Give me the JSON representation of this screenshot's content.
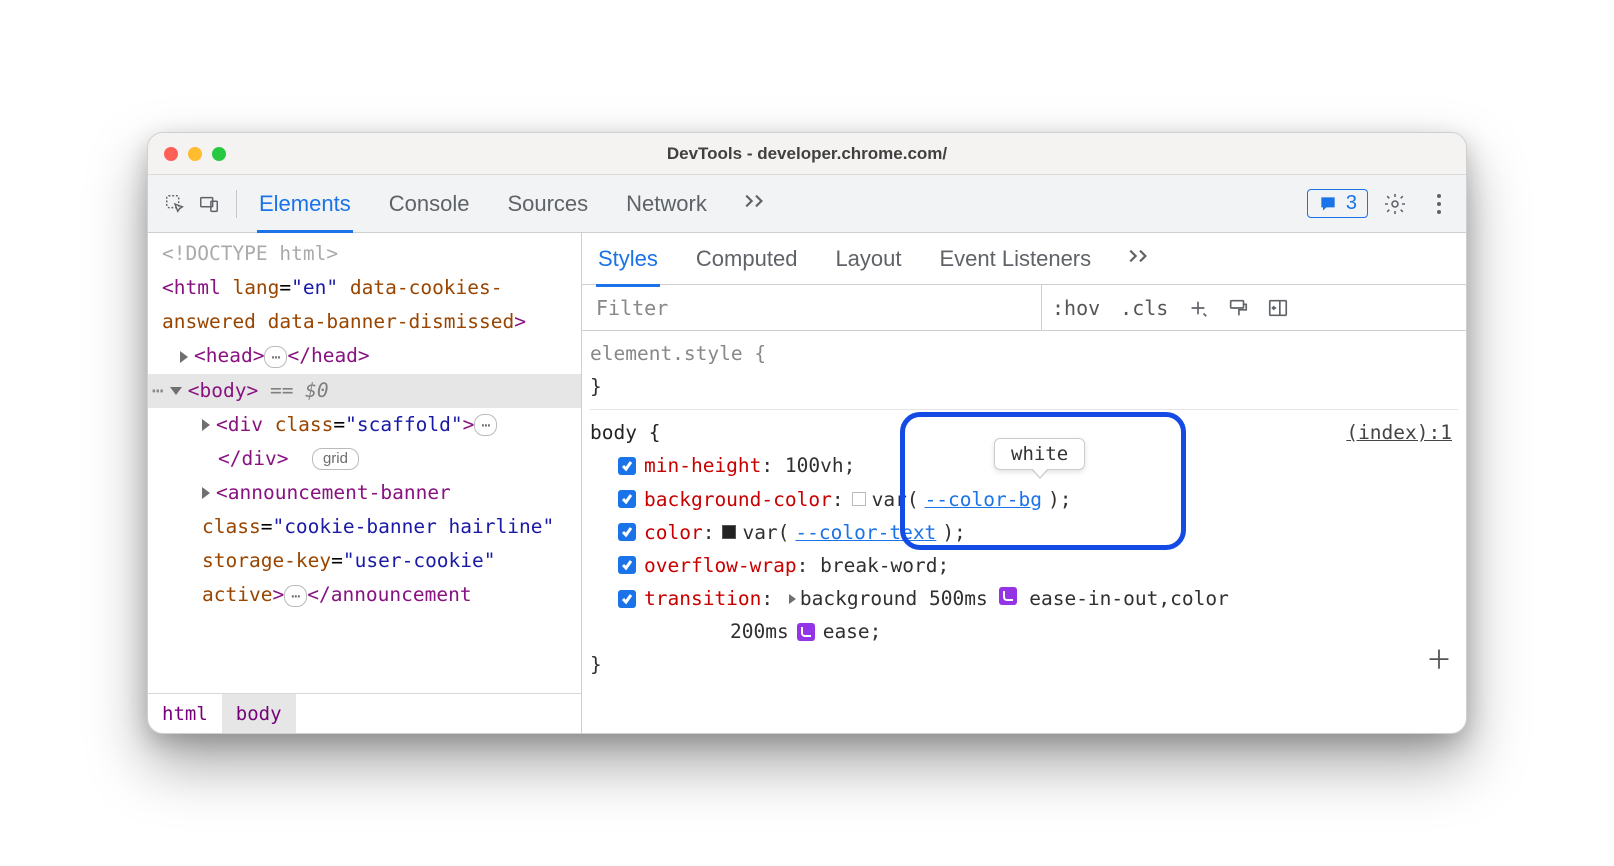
{
  "window_title": "DevTools - developer.chrome.com/",
  "toolbar": {
    "tabs": [
      "Elements",
      "Console",
      "Sources",
      "Network"
    ],
    "active_tab": 0,
    "issues_count": "3"
  },
  "dom": {
    "doctype": "<!DOCTYPE html>",
    "html_open": "<html lang=\"en\" data-cookies-answered data-banner-dismissed>",
    "head": "<head>…</head>",
    "body_line": "<body>",
    "body_suffix": "== $0",
    "scaffold_open": "<div class=\"scaffold\">",
    "scaffold_close": "</div>",
    "grid_chip": "grid",
    "announcement": "<announcement-banner class=\"cookie-banner hairline\" storage-key=\"user-cookie\" active>…</announcement-banner>"
  },
  "crumbs": [
    "html",
    "body"
  ],
  "styles": {
    "subtabs": [
      "Styles",
      "Computed",
      "Layout",
      "Event Listeners"
    ],
    "active_subtab": 0,
    "filter_placeholder": "Filter",
    "hov": ":hov",
    "cls": ".cls",
    "element_style": "element.style {",
    "close_brace": "}",
    "body_selector": "body {",
    "source_link": "(index):1",
    "props": {
      "min_height": {
        "name": "min-height",
        "value": "100vh;"
      },
      "bg": {
        "name": "background-color",
        "val_pre": "var(",
        "var": "--color-bg",
        "val_post": ");"
      },
      "color": {
        "name": "color",
        "val_pre": "var(",
        "var": "--color-text",
        "val_post": ");"
      },
      "overflow": {
        "name": "overflow-wrap",
        "value": "break-word;"
      },
      "transition": {
        "name": "transition",
        "seg1": "background 500ms",
        "ease1": "ease-in-out",
        "seg2": ",color",
        "seg3": "200ms",
        "ease2": "ease;"
      }
    },
    "tooltip": "white"
  }
}
